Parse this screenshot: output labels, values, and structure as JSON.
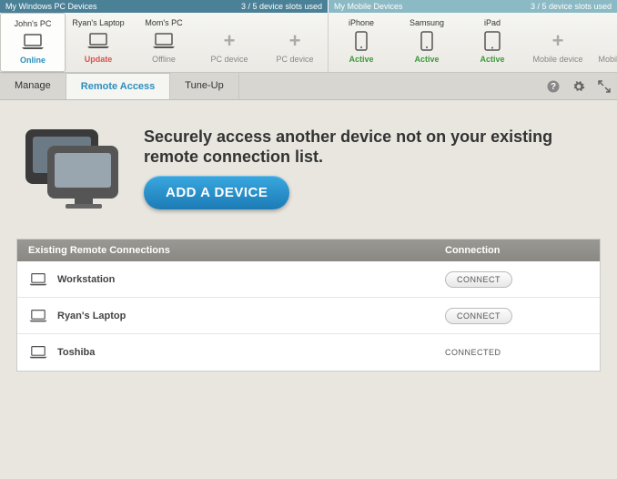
{
  "topbar": {
    "pc_label": "My Windows PC Devices",
    "pc_slots": "3 / 5 device slots used",
    "mb_label": "My Mobile Devices",
    "mb_slots": "3 / 5 device slots used"
  },
  "pc_devices": [
    {
      "name": "John's PC",
      "status": "Online",
      "cls": "st-online",
      "type": "laptop",
      "selected": true
    },
    {
      "name": "Ryan's Laptop",
      "status": "Update",
      "cls": "st-update",
      "type": "laptop"
    },
    {
      "name": "Mom's PC",
      "status": "Offline",
      "cls": "st-offline",
      "type": "laptop"
    },
    {
      "name": "",
      "status": "PC device",
      "cls": "st-empty",
      "type": "plus"
    },
    {
      "name": "",
      "status": "PC device",
      "cls": "st-empty",
      "type": "plus"
    }
  ],
  "mb_devices": [
    {
      "name": "iPhone",
      "status": "Active",
      "cls": "st-active",
      "type": "phone"
    },
    {
      "name": "Samsung",
      "status": "Active",
      "cls": "st-active",
      "type": "phone"
    },
    {
      "name": "iPad",
      "status": "Active",
      "cls": "st-active",
      "type": "tablet"
    },
    {
      "name": "",
      "status": "Mobile device",
      "cls": "st-empty",
      "type": "plus"
    },
    {
      "name": "",
      "status": "Mobile device",
      "cls": "st-empty",
      "type": "plus"
    }
  ],
  "tabs": {
    "manage": "Manage",
    "remote": "Remote Access",
    "tuneup": "Tune-Up"
  },
  "hero": {
    "title": "Securely access another device not on your existing remote connection list.",
    "button": "ADD A DEVICE"
  },
  "table": {
    "col1": "Existing Remote Connections",
    "col2": "Connection",
    "rows": [
      {
        "name": "Workstation",
        "state": "button",
        "label": "CONNECT"
      },
      {
        "name": "Ryan's Laptop",
        "state": "button",
        "label": "CONNECT"
      },
      {
        "name": "Toshiba",
        "state": "text",
        "label": "CONNECTED"
      }
    ]
  }
}
